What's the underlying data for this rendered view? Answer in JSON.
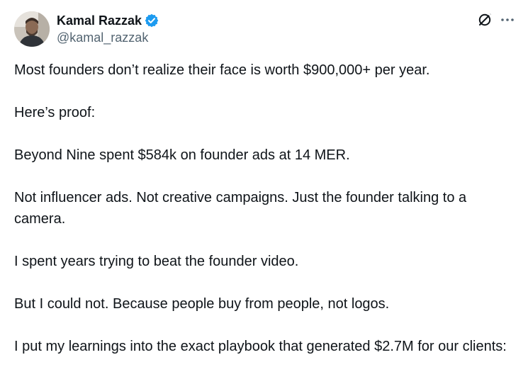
{
  "author": {
    "display_name": "Kamal Razzak",
    "handle": "@kamal_razzak",
    "avatar_icon": "avatar-photo",
    "verified_color": "#1d9bf0"
  },
  "actions": {
    "grok_icon": "grok-icon",
    "more_icon": "more-icon"
  },
  "tweet": {
    "paragraphs": [
      "Most founders don’t realize their face is worth $900,000+ per year.",
      "Here’s proof:",
      "Beyond Nine spent $584k on founder ads at 14 MER.",
      "Not influencer ads. Not creative campaigns. Just the founder talking to a camera.",
      "I spent years trying to beat the founder video.",
      "But I could not. Because people buy from people, not logos.",
      "I put my learnings into the exact playbook that generated $2.7M for our clients:"
    ]
  },
  "colors": {
    "text": "#0f1419",
    "secondary": "#536471",
    "accent": "#1d9bf0"
  }
}
